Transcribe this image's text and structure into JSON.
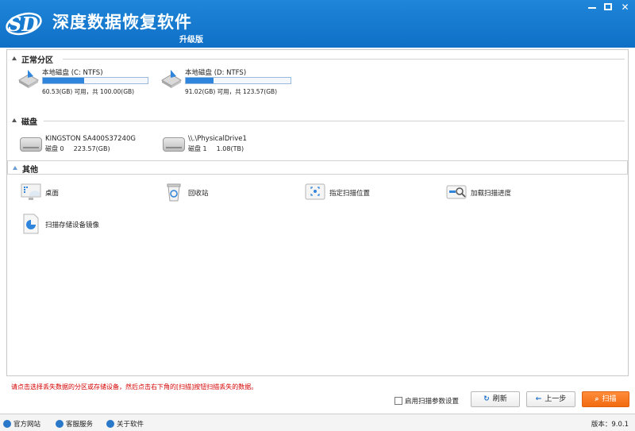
{
  "app": {
    "logo_text": "SD",
    "title": "深度数据恢复软件",
    "subtitle": "升级版"
  },
  "window_controls": [
    "minimize",
    "maximize",
    "close"
  ],
  "sections": {
    "partitions": {
      "label": "正常分区"
    },
    "disks": {
      "label": "磁盘"
    },
    "other": {
      "label": "其他"
    }
  },
  "partitions": [
    {
      "name": "本地磁盘 (C: NTFS)",
      "capacity_text": "60.53(GB) 可用，共 100.00(GB)",
      "used_fraction": 0.395,
      "icon": "drive-icon"
    },
    {
      "name": "本地磁盘 (D: NTFS)",
      "capacity_text": "91.02(GB) 可用，共 123.57(GB)",
      "used_fraction": 0.263,
      "icon": "drive-icon"
    }
  ],
  "disks": [
    {
      "name": "KINGSTON SA400S37240G",
      "disk_label": "磁盘 0",
      "size": "223.57(GB)",
      "icon": "hdd-icon"
    },
    {
      "name": "\\\\.\\PhysicalDrive1",
      "disk_label": "磁盘 1",
      "size": "1.08(TB)",
      "icon": "hdd-icon"
    }
  ],
  "tools": [
    {
      "label": "桌面",
      "icon": "desktop-icon"
    },
    {
      "label": "回收站",
      "icon": "recycle-bin-icon"
    },
    {
      "label": "指定扫描位置",
      "icon": "scan-location-icon"
    },
    {
      "label": "加载扫描进度",
      "icon": "load-progress-icon"
    },
    {
      "label": "扫描存储设备镜像",
      "icon": "disk-image-icon"
    }
  ],
  "hint": "请点击选择丢失数据的分区或存储设备，然后点击右下角的[扫描]按钮扫描丢失的数据。",
  "controls": {
    "param_checkbox": "启用扫描参数设置",
    "refresh": "刷新",
    "back": "上一步",
    "scan": "扫描"
  },
  "status": {
    "official_site": "官方网站",
    "support": "客服服务",
    "about": "关于软件",
    "version": "版本：9.0.1"
  },
  "colors": {
    "titlebar": "#1877d2",
    "progress": "#2f84db",
    "scan_button": "#f57a22",
    "hint_text": "#d40000"
  }
}
